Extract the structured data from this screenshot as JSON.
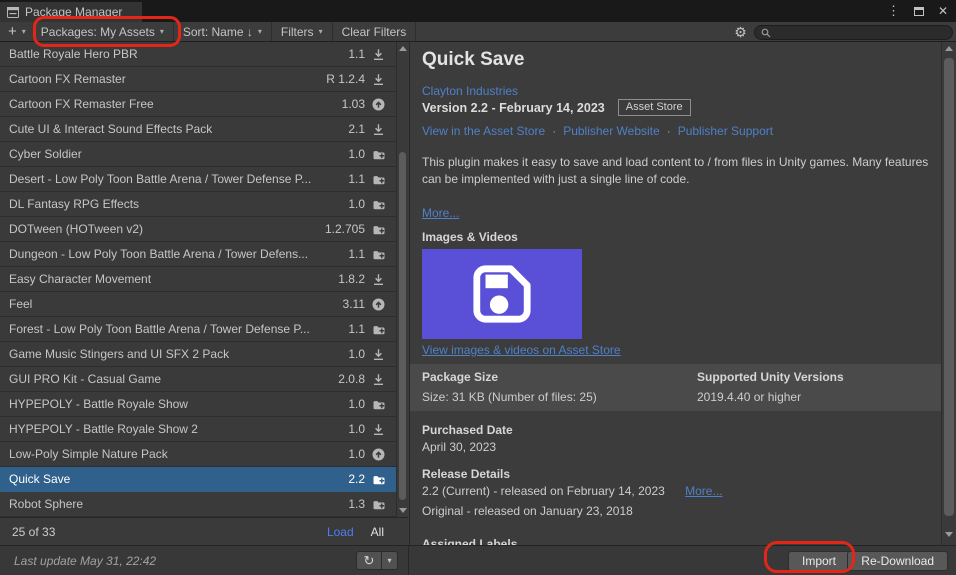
{
  "window": {
    "tab_title": "Package Manager",
    "controls": {
      "menu": "⋮",
      "maximize": "maximize",
      "close": "✕"
    }
  },
  "toolbar": {
    "add_label": "+",
    "packages_dropdown": "Packages: My Assets",
    "sort_dropdown": "Sort: Name ↓",
    "filters_dropdown": "Filters",
    "clear_filters_label": "Clear Filters",
    "search_value": ""
  },
  "package_list": {
    "items": [
      {
        "name": "Battle Royale Hero PBR",
        "version": "1.1",
        "status": "download"
      },
      {
        "name": "Cartoon FX Remaster",
        "version": "R 1.2.4",
        "status": "download"
      },
      {
        "name": "Cartoon FX Remaster Free",
        "version": "1.03",
        "status": "update"
      },
      {
        "name": "Cute UI & Interact Sound Effects Pack",
        "version": "2.1",
        "status": "download"
      },
      {
        "name": "Cyber Soldier",
        "version": "1.0",
        "status": "imported"
      },
      {
        "name": "Desert - Low Poly Toon Battle Arena / Tower Defense P...",
        "version": "1.1",
        "status": "imported"
      },
      {
        "name": "DL Fantasy RPG Effects",
        "version": "1.0",
        "status": "imported"
      },
      {
        "name": "DOTween (HOTween v2)",
        "version": "1.2.705",
        "status": "imported"
      },
      {
        "name": "Dungeon - Low Poly Toon Battle Arena / Tower Defens...",
        "version": "1.1",
        "status": "imported"
      },
      {
        "name": "Easy Character Movement",
        "version": "1.8.2",
        "status": "download"
      },
      {
        "name": "Feel",
        "version": "3.11",
        "status": "update"
      },
      {
        "name": "Forest - Low Poly Toon Battle Arena / Tower Defense P...",
        "version": "1.1",
        "status": "imported"
      },
      {
        "name": "Game Music Stingers and UI SFX 2 Pack",
        "version": "1.0",
        "status": "download"
      },
      {
        "name": "GUI PRO Kit - Casual Game",
        "version": "2.0.8",
        "status": "download"
      },
      {
        "name": "HYPEPOLY - Battle Royale Show",
        "version": "1.0",
        "status": "imported"
      },
      {
        "name": "HYPEPOLY - Battle Royale Show 2",
        "version": "1.0",
        "status": "download"
      },
      {
        "name": "Low-Poly Simple Nature Pack",
        "version": "1.0",
        "status": "update"
      },
      {
        "name": "Quick Save",
        "version": "2.2",
        "status": "imported",
        "selected": true
      },
      {
        "name": "Robot Sphere",
        "version": "1.3",
        "status": "imported"
      }
    ],
    "footer": {
      "count": "25 of 33",
      "load_label": "Load",
      "all_label": "All"
    }
  },
  "details": {
    "title": "Quick Save",
    "publisher": "Clayton Industries",
    "version_line": "Version 2.2 - February 14, 2023",
    "badge": "Asset Store",
    "links": [
      "View in the Asset Store",
      "Publisher Website",
      "Publisher Support"
    ],
    "description": "This plugin makes it easy to save and load content to / from files in Unity games. Many features can be implemented with just a single line of code.",
    "more_label": "More...",
    "images_heading": "Images & Videos",
    "images_link": "View images & videos on Asset Store",
    "package_size_heading": "Package Size",
    "package_size_value": "Size: 31 KB (Number of files: 25)",
    "supported_heading": "Supported Unity Versions",
    "supported_value": "2019.4.40 or higher",
    "purchased_heading": "Purchased Date",
    "purchased_value": "April 30, 2023",
    "release_heading": "Release Details",
    "release_current": "2.2 (Current) - released on February 14, 2023",
    "release_more_label": "More...",
    "release_original": "Original - released on January 23, 2018",
    "assigned_labels_heading": "Assigned Labels",
    "import_label": "Import",
    "redownload_label": "Re-Download"
  },
  "status_bar": {
    "last_update": "Last update May 31, 22:42"
  },
  "colors": {
    "selection_blue": "#2f618c",
    "link_blue": "#5080c8",
    "load_link_blue": "#4c7ef5",
    "annotation_red": "#e42618",
    "thumbnail_purple": "#5a50d8"
  }
}
